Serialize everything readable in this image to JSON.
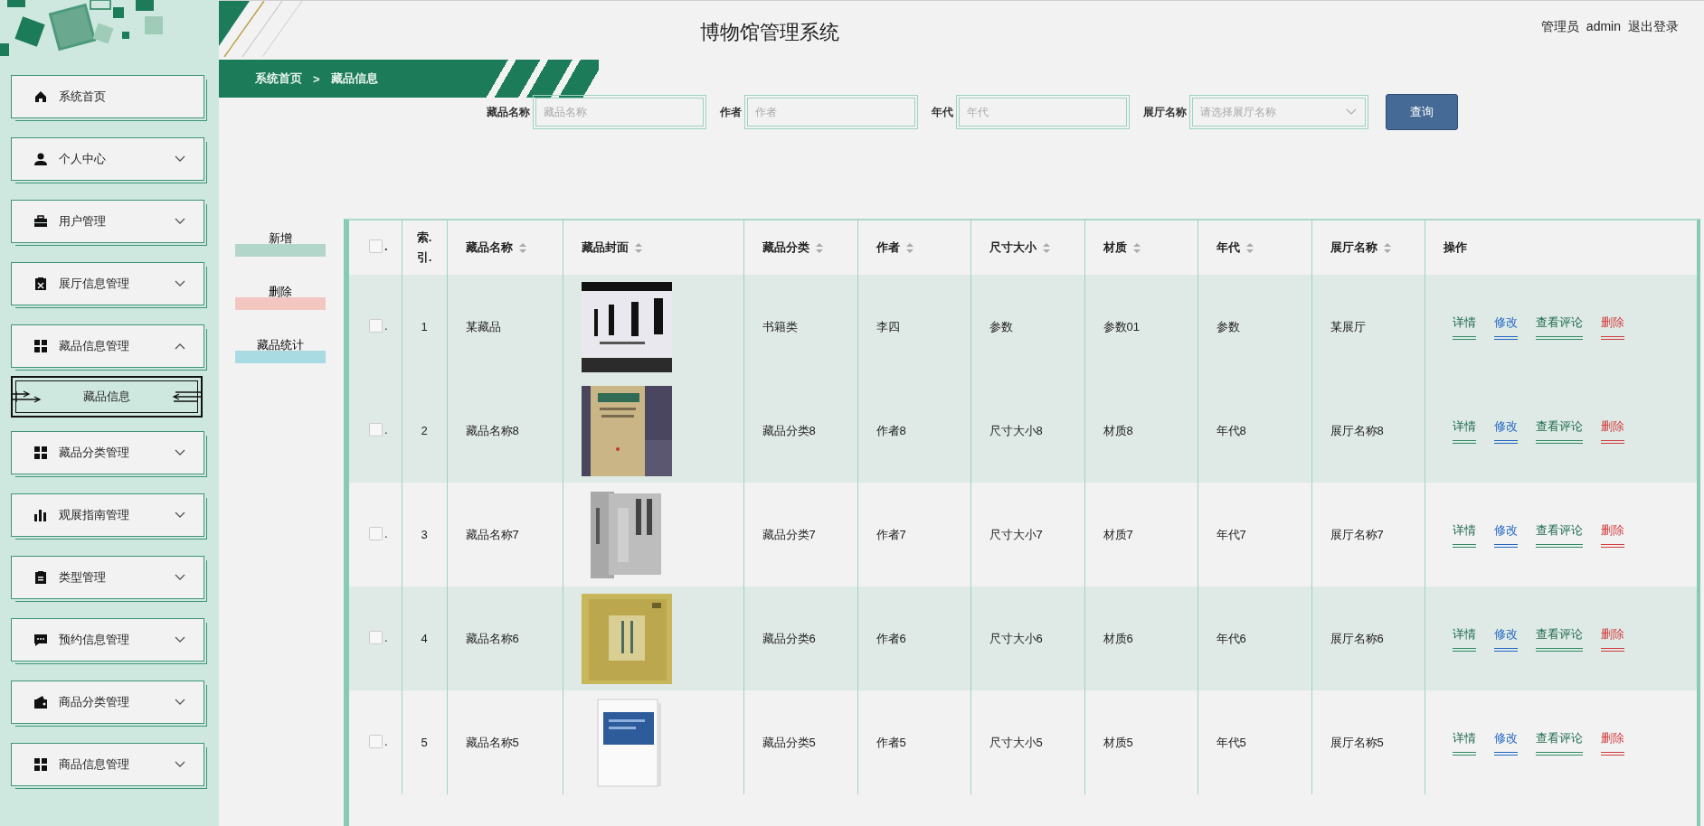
{
  "header": {
    "title": "博物馆管理系统",
    "role": "管理员",
    "username": "admin",
    "logout": "退出登录"
  },
  "breadcrumb": {
    "items": [
      "系统首页",
      "藏品信息"
    ],
    "separator": ">"
  },
  "sidebar": {
    "items": [
      {
        "label": "系统首页"
      },
      {
        "label": "个人中心",
        "expanded": false
      },
      {
        "label": "用户管理",
        "expanded": false
      },
      {
        "label": "展厅信息管理",
        "expanded": false
      },
      {
        "label": "藏品信息管理",
        "expanded": true,
        "children": [
          {
            "label": "藏品信息",
            "selected": true
          }
        ]
      },
      {
        "label": "藏品分类管理",
        "expanded": false
      },
      {
        "label": "观展指南管理",
        "expanded": false
      },
      {
        "label": "类型管理",
        "expanded": false
      },
      {
        "label": "预约信息管理",
        "expanded": false
      },
      {
        "label": "商品分类管理",
        "expanded": false
      },
      {
        "label": "商品信息管理",
        "expanded": false
      }
    ]
  },
  "search": {
    "fields": [
      {
        "kind": "input",
        "label": "藏品名称",
        "placeholder": "藏品名称"
      },
      {
        "kind": "input",
        "label": "作者",
        "placeholder": "作者"
      },
      {
        "kind": "input",
        "label": "年代",
        "placeholder": "年代"
      },
      {
        "kind": "select",
        "label": "展厅名称",
        "placeholder": "请选择展厅名称"
      }
    ],
    "button": "查询"
  },
  "actions": [
    {
      "kind": "add",
      "label": "新增"
    },
    {
      "kind": "delete",
      "label": "删除"
    },
    {
      "kind": "stats",
      "label": "藏品统计"
    }
  ],
  "table": {
    "select_all": {
      "checked": false,
      "suffix": "."
    },
    "columns": [
      {
        "label": "索.引.",
        "sortable": false
      },
      {
        "label": "藏品名称",
        "sortable": true
      },
      {
        "label": "藏品封面",
        "sortable": true
      },
      {
        "label": "藏品分类",
        "sortable": true
      },
      {
        "label": "作者",
        "sortable": true
      },
      {
        "label": "尺寸大小",
        "sortable": true
      },
      {
        "label": "材质",
        "sortable": true
      },
      {
        "label": "年代",
        "sortable": true
      },
      {
        "label": "展厅名称",
        "sortable": true
      },
      {
        "label": "操作",
        "sortable": false
      }
    ],
    "rows": [
      {
        "shaded": true,
        "checked": false,
        "suffix": ".",
        "cells": [
          "1",
          "某藏品",
          "",
          "书籍类",
          "李四",
          "参数",
          "参数01",
          "参数",
          "某展厅"
        ],
        "cover": {
          "kind": "picture"
        },
        "actions": [
          {
            "kind": "view",
            "label": "详情"
          },
          {
            "kind": "edit",
            "label": "修改"
          },
          {
            "kind": "comment",
            "label": "查看评论"
          },
          {
            "kind": "delete",
            "label": "删除"
          }
        ]
      },
      {
        "shaded": true,
        "checked": false,
        "suffix": ".",
        "cells": [
          "2",
          "藏品名称8",
          "",
          "藏品分类8",
          "作者8",
          "尺寸大小8",
          "材质8",
          "年代8",
          "展厅名称8"
        ],
        "cover": {
          "kind": "picture"
        },
        "actions": [
          {
            "kind": "view",
            "label": "详情"
          },
          {
            "kind": "edit",
            "label": "修改"
          },
          {
            "kind": "comment",
            "label": "查看评论"
          },
          {
            "kind": "delete",
            "label": "删除"
          }
        ]
      },
      {
        "shaded": false,
        "checked": false,
        "suffix": ".",
        "cells": [
          "3",
          "藏品名称7",
          "",
          "藏品分类7",
          "作者7",
          "尺寸大小7",
          "材质7",
          "年代7",
          "展厅名称7"
        ],
        "cover": {
          "kind": "picture"
        },
        "actions": [
          {
            "kind": "view",
            "label": "详情"
          },
          {
            "kind": "edit",
            "label": "修改"
          },
          {
            "kind": "comment",
            "label": "查看评论"
          },
          {
            "kind": "delete",
            "label": "删除"
          }
        ]
      },
      {
        "shaded": true,
        "checked": false,
        "suffix": ".",
        "cells": [
          "4",
          "藏品名称6",
          "",
          "藏品分类6",
          "作者6",
          "尺寸大小6",
          "材质6",
          "年代6",
          "展厅名称6"
        ],
        "cover": {
          "kind": "picture"
        },
        "actions": [
          {
            "kind": "view",
            "label": "详情"
          },
          {
            "kind": "edit",
            "label": "修改"
          },
          {
            "kind": "comment",
            "label": "查看评论"
          },
          {
            "kind": "delete",
            "label": "删除"
          }
        ]
      },
      {
        "shaded": false,
        "checked": false,
        "suffix": ".",
        "cells": [
          "5",
          "藏品名称5",
          "",
          "藏品分类5",
          "作者5",
          "尺寸大小5",
          "材质5",
          "年代5",
          "展厅名称5"
        ],
        "cover": {
          "kind": "picture"
        },
        "actions": [
          {
            "kind": "view",
            "label": "详情"
          },
          {
            "kind": "edit",
            "label": "修改"
          },
          {
            "kind": "comment",
            "label": "查看评论"
          },
          {
            "kind": "delete",
            "label": "删除"
          }
        ]
      }
    ]
  }
}
